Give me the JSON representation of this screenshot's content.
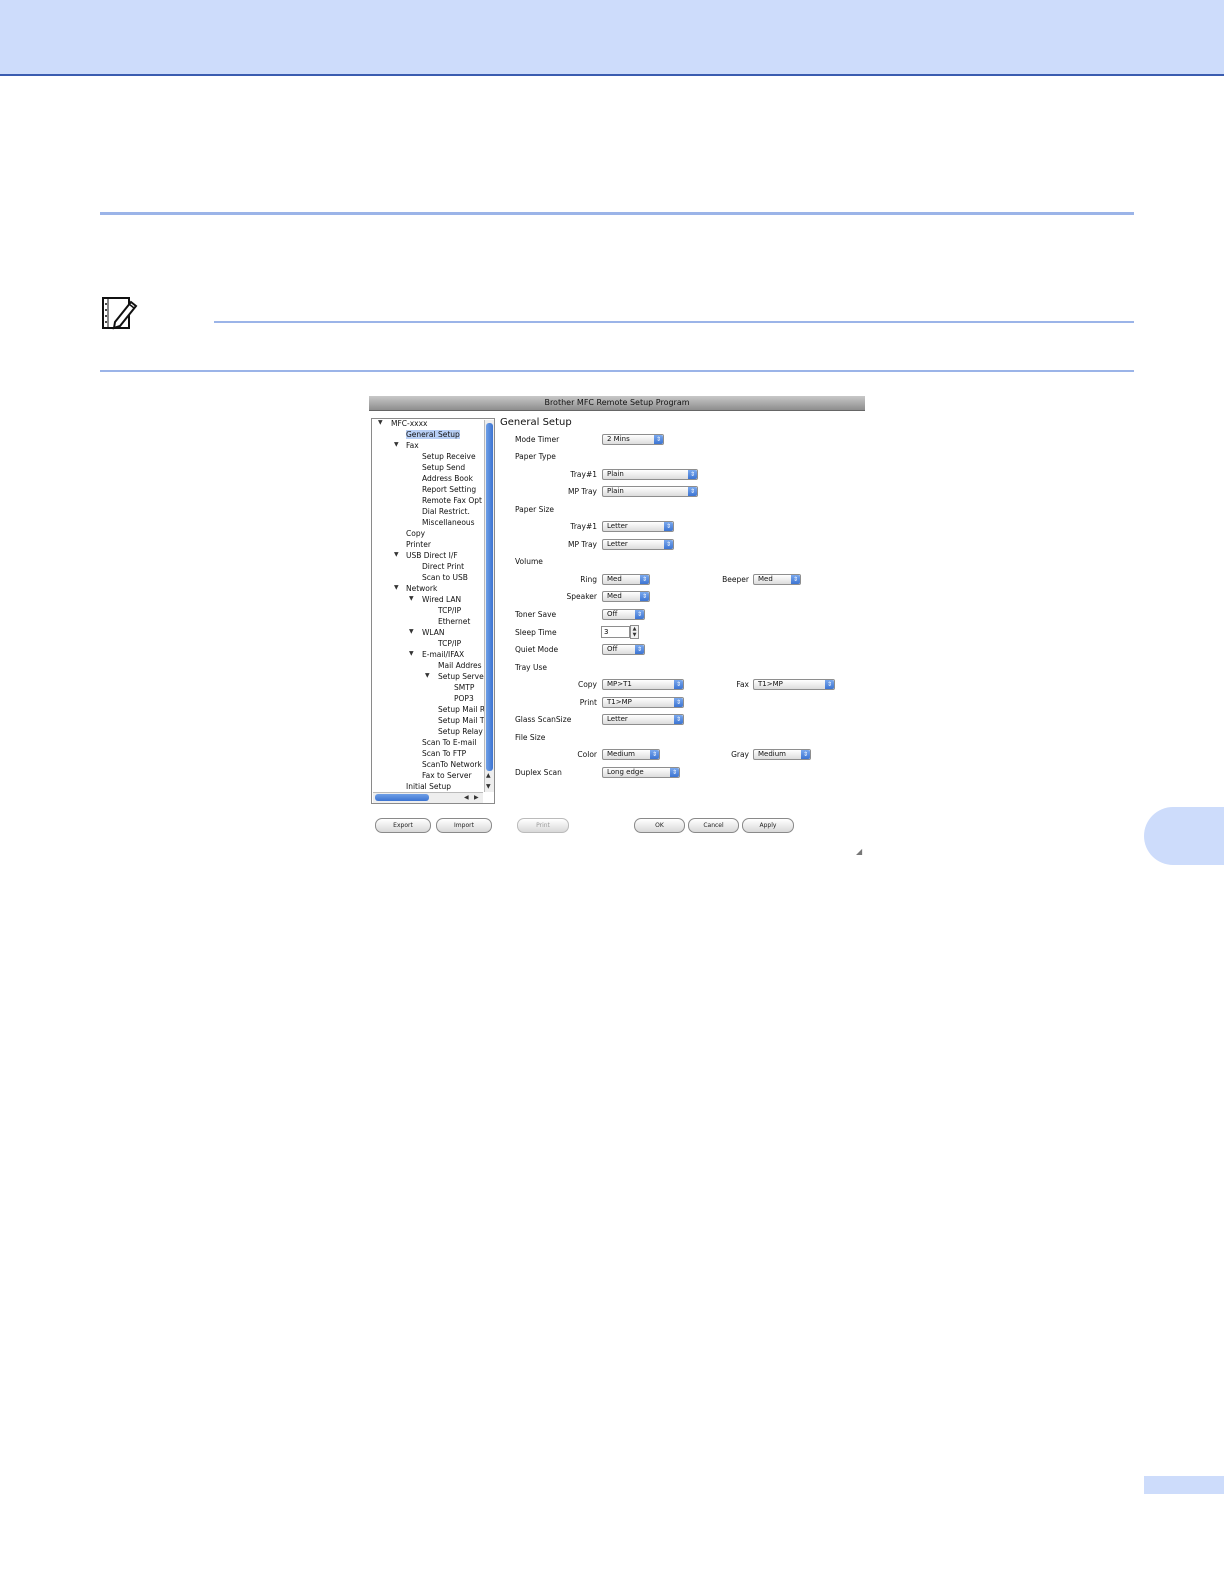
{
  "dialog": {
    "title": "Brother MFC Remote Setup Program",
    "tree": {
      "items": [
        {
          "label": "MFC-xxxx",
          "expanded": true
        },
        {
          "label": "General Setup",
          "selected": true
        },
        {
          "label": "Fax",
          "expanded": true
        },
        {
          "label": "Setup Receive"
        },
        {
          "label": "Setup Send"
        },
        {
          "label": "Address Book"
        },
        {
          "label": "Report Setting"
        },
        {
          "label": "Remote Fax Opt"
        },
        {
          "label": "Dial Restrict."
        },
        {
          "label": "Miscellaneous"
        },
        {
          "label": "Copy"
        },
        {
          "label": "Printer"
        },
        {
          "label": "USB Direct I/F",
          "expanded": true
        },
        {
          "label": "Direct Print"
        },
        {
          "label": "Scan to USB"
        },
        {
          "label": "Network",
          "expanded": true
        },
        {
          "label": "Wired LAN",
          "expanded": true
        },
        {
          "label": "TCP/IP"
        },
        {
          "label": "Ethernet"
        },
        {
          "label": "WLAN",
          "expanded": true
        },
        {
          "label": "TCP/IP"
        },
        {
          "label": "E-mail/IFAX",
          "expanded": true
        },
        {
          "label": "Mail Addres"
        },
        {
          "label": "Setup Serve",
          "expanded": true
        },
        {
          "label": "SMTP"
        },
        {
          "label": "POP3"
        },
        {
          "label": "Setup Mail R"
        },
        {
          "label": "Setup Mail T"
        },
        {
          "label": "Setup Relay"
        },
        {
          "label": "Scan To E-mail"
        },
        {
          "label": "Scan To FTP"
        },
        {
          "label": "ScanTo Network"
        },
        {
          "label": "Fax to Server"
        },
        {
          "label": "Initial Setup"
        }
      ]
    },
    "form": {
      "title": "General Setup",
      "mode_timer": {
        "label": "Mode Timer",
        "value": "2 Mins"
      },
      "paper_type": {
        "label": "Paper Type",
        "tray1": {
          "label": "Tray#1",
          "value": "Plain"
        },
        "mp_tray": {
          "label": "MP Tray",
          "value": "Plain"
        }
      },
      "paper_size": {
        "label": "Paper Size",
        "tray1": {
          "label": "Tray#1",
          "value": "Letter"
        },
        "mp_tray": {
          "label": "MP Tray",
          "value": "Letter"
        }
      },
      "volume": {
        "label": "Volume",
        "ring": {
          "label": "Ring",
          "value": "Med"
        },
        "beeper": {
          "label": "Beeper",
          "value": "Med"
        },
        "speaker": {
          "label": "Speaker",
          "value": "Med"
        }
      },
      "toner_save": {
        "label": "Toner Save",
        "value": "Off"
      },
      "sleep_time": {
        "label": "Sleep Time",
        "value": "3"
      },
      "quiet_mode": {
        "label": "Quiet Mode",
        "value": "Off"
      },
      "tray_use": {
        "label": "Tray Use",
        "copy": {
          "label": "Copy",
          "value": "MP>T1"
        },
        "fax": {
          "label": "Fax",
          "value": "T1>MP"
        },
        "print": {
          "label": "Print",
          "value": "T1>MP"
        }
      },
      "glass_scan_size": {
        "label": "Glass ScanSize",
        "value": "Letter"
      },
      "file_size": {
        "label": "File Size",
        "color": {
          "label": "Color",
          "value": "Medium"
        },
        "gray": {
          "label": "Gray",
          "value": "Medium"
        }
      },
      "duplex_scan": {
        "label": "Duplex Scan",
        "value": "Long edge"
      }
    },
    "buttons": {
      "export": "Export",
      "import": "Import",
      "print": "Print",
      "ok": "OK",
      "cancel": "Cancel",
      "apply": "Apply"
    }
  },
  "colors": {
    "accent_band": "#cddcfb",
    "rule": "#9bb4e8",
    "selection": "#b8cff5"
  }
}
